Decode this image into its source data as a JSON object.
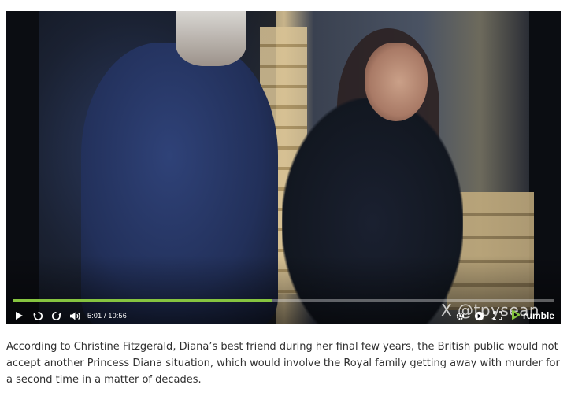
{
  "video": {
    "progress": 0.478,
    "time_display": "5:01 / 10:56",
    "watermark": "X @tpysean",
    "brand": "rumble",
    "accent_color": "#86c440"
  },
  "controls": {
    "play_icon": "play-icon",
    "rewind_icon": "rewind-icon",
    "forward_icon": "forward-icon",
    "volume_icon": "volume-icon",
    "settings_icon": "gear-icon",
    "pip_icon": "pip-icon",
    "fullscreen_icon": "fullscreen-icon",
    "brand_icon": "rumble-logo-icon"
  },
  "article": {
    "caption": "According to Christine Fitzgerald, Diana’s best friend during her final few years, the British public would not accept another Princess Diana situation, which would involve the Royal family getting away with murder for a second time in a matter of decades."
  }
}
